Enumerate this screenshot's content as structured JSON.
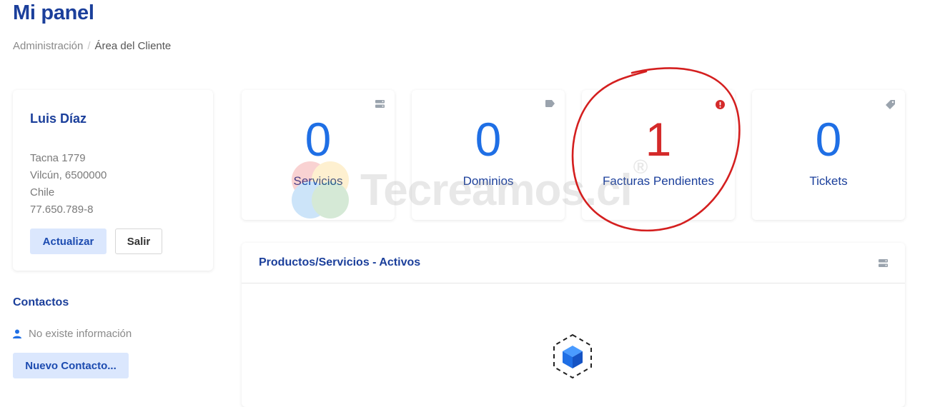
{
  "header": {
    "title": "Mi panel",
    "breadcrumb": {
      "root": "Administración",
      "separator": "/",
      "current": "Área del Cliente"
    }
  },
  "profile": {
    "name": "Luis Díaz",
    "address_lines": [
      "Tacna 1779",
      "Vilcún, 6500000",
      "Chile",
      "77.650.789-8"
    ],
    "update_label": "Actualizar",
    "logout_label": "Salir"
  },
  "contacts": {
    "title": "Contactos",
    "empty_text": "No existe información",
    "new_label": "Nuevo Contacto..."
  },
  "stats": [
    {
      "value": "0",
      "label": "Servicios",
      "icon": "server-icon"
    },
    {
      "value": "0",
      "label": "Dominios",
      "icon": "tag-icon"
    },
    {
      "value": "1",
      "label": "Facturas Pendientes",
      "icon": "alert-icon",
      "color": "#d42a2a"
    },
    {
      "value": "0",
      "label": "Tickets",
      "icon": "ticket-icon"
    }
  ],
  "products": {
    "title": "Productos/Servicios - Activos",
    "icon": "server-icon"
  },
  "watermark": {
    "text": "Tecreamos.cl",
    "mark": "®"
  },
  "colors": {
    "accent": "#1f6fe5",
    "heading": "#1b3f9b",
    "alert": "#d42a2a",
    "button_light": "#dbe7fd"
  }
}
